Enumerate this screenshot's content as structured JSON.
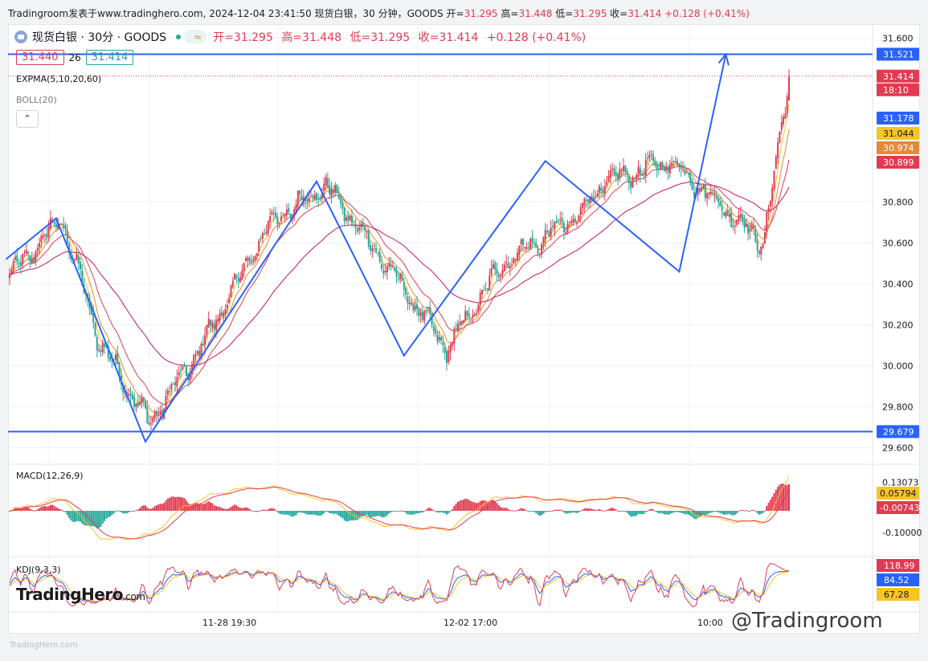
{
  "watermark_top": {
    "site": "Tradingroom发表于www.tradinghero.com, 2024-12-04 23:41:50",
    "symbol_info": "现货白银，30 分钟，GOODS",
    "open_lbl": "开=",
    "open": "31.295",
    "high_lbl": "高=",
    "high": "31.448",
    "low_lbl": "低=",
    "low": "31.295",
    "close_lbl": "收=",
    "close": "31.414",
    "change": "+0.128 (+0.41%)"
  },
  "header": {
    "symbol": "现货白银 · 30分 · GOODS",
    "open": "开=31.295",
    "high": "高=31.448",
    "low": "低=31.295",
    "close": "收=31.414",
    "change": "+0.128 (+0.41%)"
  },
  "price_box": {
    "bid": "31.440",
    "spread": "26",
    "ask": "31.414"
  },
  "indicators": {
    "expma": "EXPMA(5,10,20,60)",
    "boll": "BOLL(20)",
    "macd": "MACD(12,26,9)",
    "kdj": "KDJ(9,3,3)"
  },
  "colors": {
    "up": "#e13b52",
    "down": "#26a69a",
    "trendline": "#2962ff",
    "ema5": "#f7c325",
    "ema10": "#e4893b",
    "ema20": "#e13b52",
    "ema60": "#c2185b"
  },
  "chart_data": [
    {
      "type": "candlestick",
      "title": "现货白银 · 30分 · GOODS",
      "ylim": [
        29.52,
        31.66
      ],
      "y_ticks": [
        31.6,
        30.8,
        30.6,
        30.4,
        30.2,
        30.0,
        29.8,
        29.6
      ],
      "y_tick_labels": [
        "31.600",
        "30.800",
        "30.600",
        "30.400",
        "30.200",
        "30.000",
        "29.800",
        "29.600"
      ],
      "x_tick_labels": [
        "11-28 19:30",
        "12-02 17:00",
        "10:00"
      ],
      "horizontal_lines": [
        31.521,
        29.679
      ],
      "price_tags": [
        {
          "label": "31.521",
          "value": 31.521,
          "color": "#2962ff"
        },
        {
          "label": "31.414",
          "value": 31.414,
          "color": "#e13b52"
        },
        {
          "label": "18:10",
          "value": 31.414,
          "color": "#e13b52"
        },
        {
          "label": "31.178",
          "value": 31.178,
          "color": "#2962ff"
        },
        {
          "label": "31.044",
          "value": 31.044,
          "color": "#f7c325"
        },
        {
          "label": "30.974",
          "value": 30.974,
          "color": "#e4893b"
        },
        {
          "label": "30.899",
          "value": 30.899,
          "color": "#e13b52"
        },
        {
          "label": "29.679",
          "value": 29.679,
          "color": "#2962ff"
        }
      ],
      "waypoints": [
        {
          "t": 0,
          "p": 30.44
        },
        {
          "t": 28,
          "p": 30.72
        },
        {
          "t": 48,
          "p": 30.12
        },
        {
          "t": 75,
          "p": 29.72
        },
        {
          "t": 100,
          "p": 30.05
        },
        {
          "t": 140,
          "p": 30.7
        },
        {
          "t": 170,
          "p": 30.88
        },
        {
          "t": 210,
          "p": 30.4
        },
        {
          "t": 235,
          "p": 30.08
        },
        {
          "t": 265,
          "p": 30.5
        },
        {
          "t": 305,
          "p": 30.73
        },
        {
          "t": 320,
          "p": 30.9
        },
        {
          "t": 355,
          "p": 31.0
        },
        {
          "t": 385,
          "p": 30.76
        },
        {
          "t": 405,
          "p": 30.6
        },
        {
          "t": 414,
          "p": 31.1
        },
        {
          "t": 419,
          "p": 31.414
        }
      ],
      "trend_lines": [
        {
          "points": [
            [
              -2,
              30.52
            ],
            [
              25,
              30.72
            ],
            [
              73,
              29.63
            ],
            [
              165,
              30.9
            ],
            [
              212,
              30.05
            ],
            [
              288,
              31.0
            ],
            [
              360,
              30.46
            ],
            [
              385,
              31.52
            ]
          ]
        }
      ]
    },
    {
      "type": "bar+line",
      "title": "MACD(12,26,9)",
      "y_tick_labels": [
        "0.13073",
        "-0.10000"
      ],
      "y_ticks": [
        0.13073,
        -0.1
      ],
      "tags": [
        {
          "label": "0.05794",
          "value": 0.05794,
          "color": "#f7c325"
        },
        {
          "label": "-0.00743",
          "value": -0.00743,
          "color": "#e13b52"
        }
      ]
    },
    {
      "type": "line",
      "title": "KDJ(9,3,3)",
      "tags": [
        {
          "label": "118.99",
          "value": 118.99,
          "color": "#e13b52"
        },
        {
          "label": "84.52",
          "value": 84.52,
          "color": "#2962ff"
        },
        {
          "label": "67.28",
          "value": 67.28,
          "color": "#f7c325"
        }
      ]
    }
  ],
  "branding": {
    "logo": "TradingHero",
    "logo_suffix": ".com",
    "watermark": "@Tradingroom",
    "small_wm": "TradingHero.com"
  }
}
